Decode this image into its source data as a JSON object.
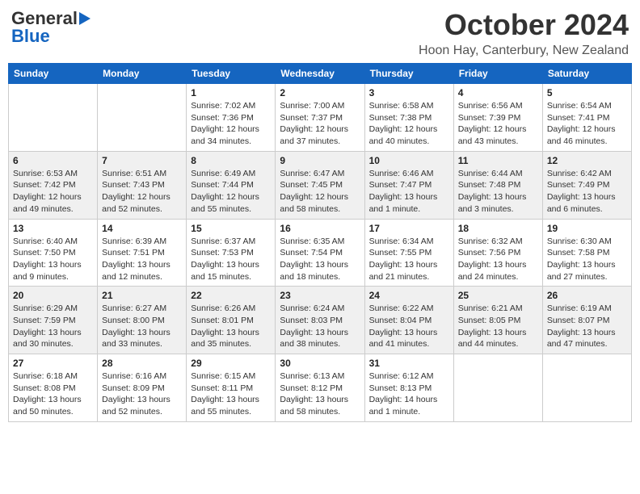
{
  "header": {
    "logo_general": "General",
    "logo_blue": "Blue",
    "month": "October 2024",
    "location": "Hoon Hay, Canterbury, New Zealand"
  },
  "days_of_week": [
    "Sunday",
    "Monday",
    "Tuesday",
    "Wednesday",
    "Thursday",
    "Friday",
    "Saturday"
  ],
  "weeks": [
    [
      {
        "day": "",
        "sunrise": "",
        "sunset": "",
        "daylight": ""
      },
      {
        "day": "",
        "sunrise": "",
        "sunset": "",
        "daylight": ""
      },
      {
        "day": "1",
        "sunrise": "Sunrise: 7:02 AM",
        "sunset": "Sunset: 7:36 PM",
        "daylight": "Daylight: 12 hours and 34 minutes."
      },
      {
        "day": "2",
        "sunrise": "Sunrise: 7:00 AM",
        "sunset": "Sunset: 7:37 PM",
        "daylight": "Daylight: 12 hours and 37 minutes."
      },
      {
        "day": "3",
        "sunrise": "Sunrise: 6:58 AM",
        "sunset": "Sunset: 7:38 PM",
        "daylight": "Daylight: 12 hours and 40 minutes."
      },
      {
        "day": "4",
        "sunrise": "Sunrise: 6:56 AM",
        "sunset": "Sunset: 7:39 PM",
        "daylight": "Daylight: 12 hours and 43 minutes."
      },
      {
        "day": "5",
        "sunrise": "Sunrise: 6:54 AM",
        "sunset": "Sunset: 7:41 PM",
        "daylight": "Daylight: 12 hours and 46 minutes."
      }
    ],
    [
      {
        "day": "6",
        "sunrise": "Sunrise: 6:53 AM",
        "sunset": "Sunset: 7:42 PM",
        "daylight": "Daylight: 12 hours and 49 minutes."
      },
      {
        "day": "7",
        "sunrise": "Sunrise: 6:51 AM",
        "sunset": "Sunset: 7:43 PM",
        "daylight": "Daylight: 12 hours and 52 minutes."
      },
      {
        "day": "8",
        "sunrise": "Sunrise: 6:49 AM",
        "sunset": "Sunset: 7:44 PM",
        "daylight": "Daylight: 12 hours and 55 minutes."
      },
      {
        "day": "9",
        "sunrise": "Sunrise: 6:47 AM",
        "sunset": "Sunset: 7:45 PM",
        "daylight": "Daylight: 12 hours and 58 minutes."
      },
      {
        "day": "10",
        "sunrise": "Sunrise: 6:46 AM",
        "sunset": "Sunset: 7:47 PM",
        "daylight": "Daylight: 13 hours and 1 minute."
      },
      {
        "day": "11",
        "sunrise": "Sunrise: 6:44 AM",
        "sunset": "Sunset: 7:48 PM",
        "daylight": "Daylight: 13 hours and 3 minutes."
      },
      {
        "day": "12",
        "sunrise": "Sunrise: 6:42 AM",
        "sunset": "Sunset: 7:49 PM",
        "daylight": "Daylight: 13 hours and 6 minutes."
      }
    ],
    [
      {
        "day": "13",
        "sunrise": "Sunrise: 6:40 AM",
        "sunset": "Sunset: 7:50 PM",
        "daylight": "Daylight: 13 hours and 9 minutes."
      },
      {
        "day": "14",
        "sunrise": "Sunrise: 6:39 AM",
        "sunset": "Sunset: 7:51 PM",
        "daylight": "Daylight: 13 hours and 12 minutes."
      },
      {
        "day": "15",
        "sunrise": "Sunrise: 6:37 AM",
        "sunset": "Sunset: 7:53 PM",
        "daylight": "Daylight: 13 hours and 15 minutes."
      },
      {
        "day": "16",
        "sunrise": "Sunrise: 6:35 AM",
        "sunset": "Sunset: 7:54 PM",
        "daylight": "Daylight: 13 hours and 18 minutes."
      },
      {
        "day": "17",
        "sunrise": "Sunrise: 6:34 AM",
        "sunset": "Sunset: 7:55 PM",
        "daylight": "Daylight: 13 hours and 21 minutes."
      },
      {
        "day": "18",
        "sunrise": "Sunrise: 6:32 AM",
        "sunset": "Sunset: 7:56 PM",
        "daylight": "Daylight: 13 hours and 24 minutes."
      },
      {
        "day": "19",
        "sunrise": "Sunrise: 6:30 AM",
        "sunset": "Sunset: 7:58 PM",
        "daylight": "Daylight: 13 hours and 27 minutes."
      }
    ],
    [
      {
        "day": "20",
        "sunrise": "Sunrise: 6:29 AM",
        "sunset": "Sunset: 7:59 PM",
        "daylight": "Daylight: 13 hours and 30 minutes."
      },
      {
        "day": "21",
        "sunrise": "Sunrise: 6:27 AM",
        "sunset": "Sunset: 8:00 PM",
        "daylight": "Daylight: 13 hours and 33 minutes."
      },
      {
        "day": "22",
        "sunrise": "Sunrise: 6:26 AM",
        "sunset": "Sunset: 8:01 PM",
        "daylight": "Daylight: 13 hours and 35 minutes."
      },
      {
        "day": "23",
        "sunrise": "Sunrise: 6:24 AM",
        "sunset": "Sunset: 8:03 PM",
        "daylight": "Daylight: 13 hours and 38 minutes."
      },
      {
        "day": "24",
        "sunrise": "Sunrise: 6:22 AM",
        "sunset": "Sunset: 8:04 PM",
        "daylight": "Daylight: 13 hours and 41 minutes."
      },
      {
        "day": "25",
        "sunrise": "Sunrise: 6:21 AM",
        "sunset": "Sunset: 8:05 PM",
        "daylight": "Daylight: 13 hours and 44 minutes."
      },
      {
        "day": "26",
        "sunrise": "Sunrise: 6:19 AM",
        "sunset": "Sunset: 8:07 PM",
        "daylight": "Daylight: 13 hours and 47 minutes."
      }
    ],
    [
      {
        "day": "27",
        "sunrise": "Sunrise: 6:18 AM",
        "sunset": "Sunset: 8:08 PM",
        "daylight": "Daylight: 13 hours and 50 minutes."
      },
      {
        "day": "28",
        "sunrise": "Sunrise: 6:16 AM",
        "sunset": "Sunset: 8:09 PM",
        "daylight": "Daylight: 13 hours and 52 minutes."
      },
      {
        "day": "29",
        "sunrise": "Sunrise: 6:15 AM",
        "sunset": "Sunset: 8:11 PM",
        "daylight": "Daylight: 13 hours and 55 minutes."
      },
      {
        "day": "30",
        "sunrise": "Sunrise: 6:13 AM",
        "sunset": "Sunset: 8:12 PM",
        "daylight": "Daylight: 13 hours and 58 minutes."
      },
      {
        "day": "31",
        "sunrise": "Sunrise: 6:12 AM",
        "sunset": "Sunset: 8:13 PM",
        "daylight": "Daylight: 14 hours and 1 minute."
      },
      {
        "day": "",
        "sunrise": "",
        "sunset": "",
        "daylight": ""
      },
      {
        "day": "",
        "sunrise": "",
        "sunset": "",
        "daylight": ""
      }
    ]
  ]
}
